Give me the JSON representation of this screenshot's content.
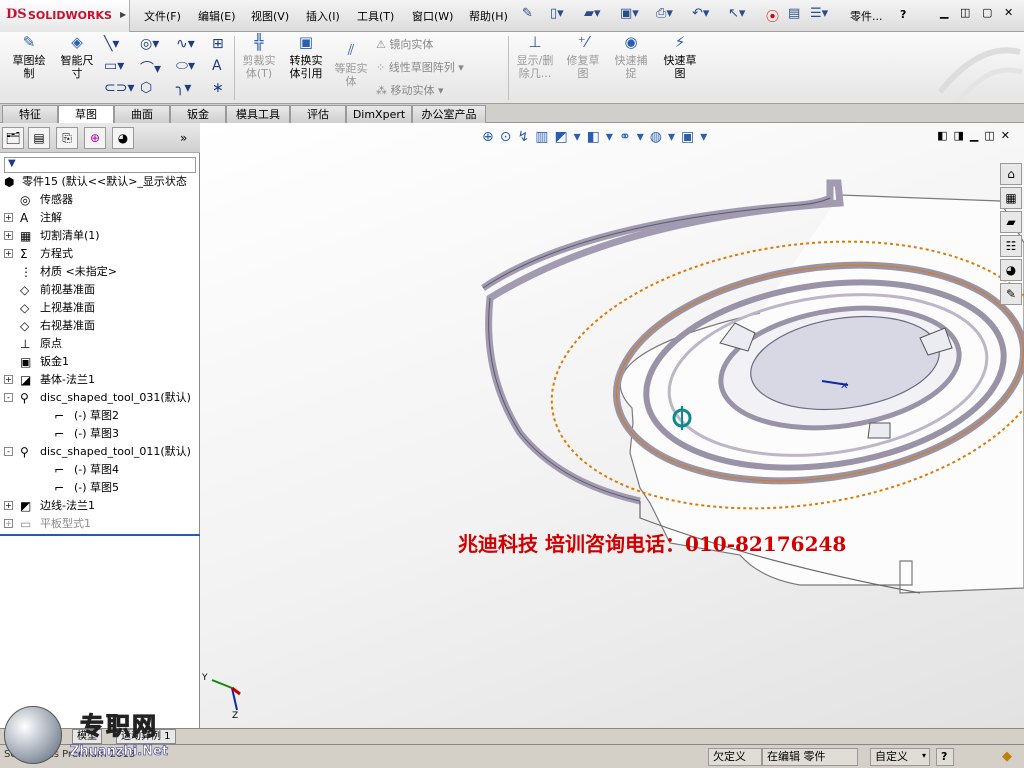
{
  "app": {
    "logo_mark": "DS",
    "logo_text": "SOLIDWORKS",
    "part_name": "零件...",
    "help_icon": "?"
  },
  "menu": [
    "文件(F)",
    "编辑(E)",
    "视图(V)",
    "插入(I)",
    "工具(T)",
    "窗口(W)",
    "帮助(H)"
  ],
  "ribbon": {
    "sketch": "草图绘\n制",
    "smart_dim": "智能尺\n寸",
    "trim": "剪裁实\n体(T)",
    "convert": "转换实\n体引用",
    "offset": "等距实\n体",
    "mirror": "镜向实体",
    "linear_pattern": "线性草图阵列",
    "move": "移动实体",
    "show_hide": "显示/删\n除几...",
    "repair": "修复草\n图",
    "quick_snap": "快速捕\n捉",
    "rapid_sketch": "快速草\n图"
  },
  "tabs": [
    "特征",
    "草图",
    "曲面",
    "钣金",
    "模具工具",
    "评估",
    "DimXpert",
    "办公室产品"
  ],
  "active_tab": "草图",
  "tree": {
    "root": "零件15  (默认<<默认>_显示状态",
    "items": [
      {
        "label": "传感器",
        "icon": "sensor-icon",
        "expander": ""
      },
      {
        "label": "注解",
        "icon": "annotation-icon",
        "expander": "+"
      },
      {
        "label": "切割清单(1)",
        "icon": "cutlist-icon",
        "expander": "+"
      },
      {
        "label": "方程式",
        "icon": "equation-icon",
        "expander": "+"
      },
      {
        "label": "材质 <未指定>",
        "icon": "material-icon",
        "expander": ""
      },
      {
        "label": "前视基准面",
        "icon": "plane-icon",
        "expander": ""
      },
      {
        "label": "上视基准面",
        "icon": "plane-icon",
        "expander": ""
      },
      {
        "label": "右视基准面",
        "icon": "plane-icon",
        "expander": ""
      },
      {
        "label": "原点",
        "icon": "origin-icon",
        "expander": ""
      },
      {
        "label": "钣金1",
        "icon": "sheetmetal-icon",
        "expander": ""
      },
      {
        "label": "基体-法兰1",
        "icon": "flange-icon",
        "expander": "+"
      },
      {
        "label": "disc_shaped_tool_031(默认)",
        "icon": "formtool-icon",
        "expander": "-"
      },
      {
        "label": "(-) 草图2",
        "icon": "sketch-icon",
        "expander": "",
        "indent": true
      },
      {
        "label": "(-) 草图3",
        "icon": "sketch-icon",
        "expander": "",
        "indent": true
      },
      {
        "label": "disc_shaped_tool_011(默认)",
        "icon": "formtool-icon",
        "expander": "-"
      },
      {
        "label": "(-) 草图4",
        "icon": "sketch-icon",
        "expander": "",
        "indent": true
      },
      {
        "label": "(-) 草图5",
        "icon": "sketch-icon",
        "expander": "",
        "indent": true
      },
      {
        "label": "边线-法兰1",
        "icon": "edgeflange-icon",
        "expander": "+"
      },
      {
        "label": "平板型式1",
        "icon": "flatpattern-icon",
        "expander": "+",
        "gray": true
      }
    ]
  },
  "viewport": {
    "watermark": "兆迪科技    培训咨询电话：010-82176248",
    "triad_y": "Y",
    "triad_z": "Z"
  },
  "bottom_tabs": [
    "模型",
    "运动算例 1"
  ],
  "status": {
    "app_version": "SolidWorks Premium 2013",
    "under_defined": "欠定义",
    "editing": "在编辑 零件",
    "custom": "自定义",
    "help": "?"
  },
  "site": {
    "name": "专职网",
    "url": "Zhuanzhi.Net"
  }
}
